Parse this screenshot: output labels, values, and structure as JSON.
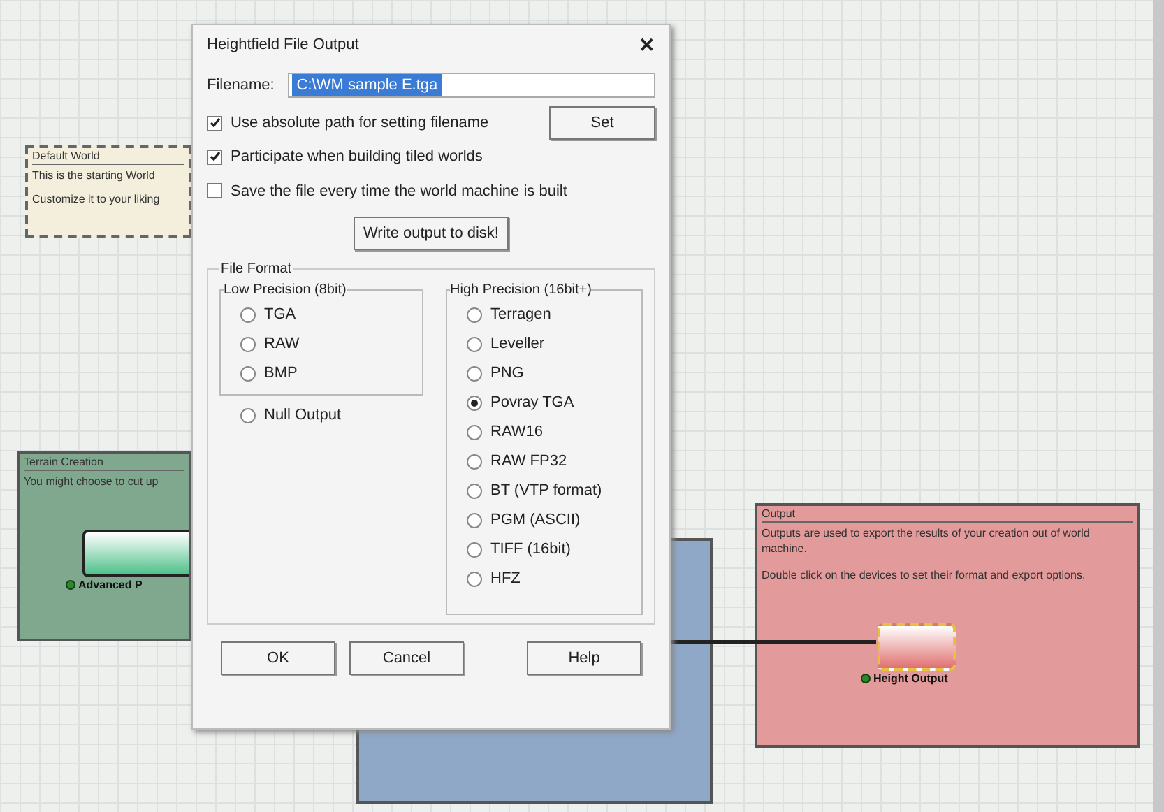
{
  "canvas": {
    "groups": [
      {
        "kind": "comment",
        "title": "Default World",
        "lines": [
          "This is the starting World",
          "Customize it to your liking"
        ],
        "color": "#f3efdc"
      },
      {
        "kind": "group",
        "title": "Terrain Creation",
        "lines": [
          "You might choose to cut up"
        ],
        "color": "#7fa88f",
        "device": {
          "label": "Advanced P",
          "color": "#4fc08a"
        }
      },
      {
        "kind": "group",
        "color": "#8fa8c8"
      },
      {
        "kind": "group",
        "title": "Output",
        "lines": [
          "Outputs are used to export the results of your creation out of world machine.",
          "Double click on the devices to set their format and export options."
        ],
        "color": "#e39a9a",
        "device": {
          "label": "Height Output",
          "color": "#e07070"
        }
      }
    ]
  },
  "dialog": {
    "title": "Heightfield File Output",
    "close": "✕",
    "filename": {
      "label": "Filename:",
      "value": "C:\\WM sample E.tga"
    },
    "options": [
      {
        "label": "Use absolute path for setting filename",
        "checked": true
      },
      {
        "label": "Participate when building tiled worlds",
        "checked": true
      },
      {
        "label": "Save the file every time the world machine is built",
        "checked": false
      }
    ],
    "set_button": "Set",
    "write_button": "Write output to disk!",
    "file_format": {
      "title": "File Format",
      "low": {
        "title": "Low Precision (8bit)",
        "options": [
          {
            "label": "TGA",
            "selected": false
          },
          {
            "label": "RAW",
            "selected": false
          },
          {
            "label": "BMP",
            "selected": false
          }
        ]
      },
      "null_output": {
        "label": "Null Output",
        "selected": false
      },
      "high": {
        "title": "High Precision (16bit+)",
        "options": [
          {
            "label": "Terragen",
            "selected": false
          },
          {
            "label": "Leveller",
            "selected": false
          },
          {
            "label": "PNG",
            "selected": false
          },
          {
            "label": "Povray TGA",
            "selected": true
          },
          {
            "label": "RAW16",
            "selected": false
          },
          {
            "label": "RAW FP32",
            "selected": false
          },
          {
            "label": "BT (VTP format)",
            "selected": false
          },
          {
            "label": "PGM (ASCII)",
            "selected": false
          },
          {
            "label": "TIFF (16bit)",
            "selected": false
          },
          {
            "label": "HFZ",
            "selected": false
          }
        ]
      }
    },
    "buttons": [
      "OK",
      "Cancel",
      "Help"
    ]
  }
}
